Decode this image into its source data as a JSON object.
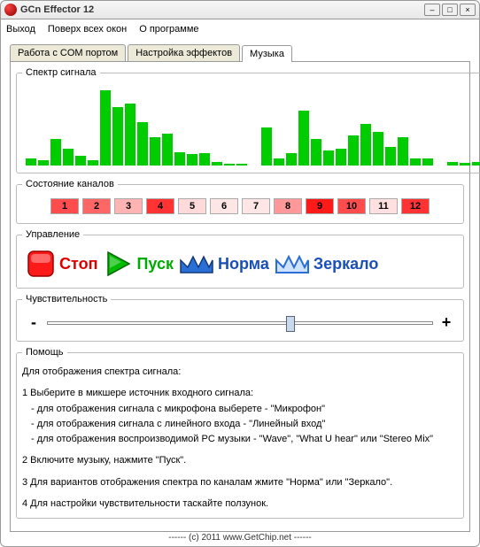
{
  "window": {
    "title": "GCn Effector 12"
  },
  "menu": {
    "exit": "Выход",
    "ontop": "Поверх всех окон",
    "about": "О программе"
  },
  "tabs": {
    "com": "Работа с COM портом",
    "effects": "Настройка эффектов",
    "music": "Музыка"
  },
  "spectrum": {
    "legend": "Спектр сигнала"
  },
  "chart_data": {
    "type": "bar",
    "title": "Спектр сигнала",
    "xlabel": "",
    "ylabel": "",
    "ylim": [
      0,
      100
    ],
    "values": [
      8,
      6,
      32,
      20,
      12,
      6,
      90,
      70,
      74,
      52,
      34,
      38,
      16,
      14,
      15,
      4,
      2,
      2,
      0,
      45,
      8,
      15,
      65,
      32,
      18,
      20,
      36,
      50,
      40,
      22,
      34,
      8,
      8,
      0,
      4,
      3,
      4,
      4,
      3,
      3
    ]
  },
  "channels": {
    "legend": "Состояние каналов",
    "items": [
      {
        "n": "1",
        "c": "#ff4d4d"
      },
      {
        "n": "2",
        "c": "#ff6666"
      },
      {
        "n": "3",
        "c": "#ffb3b3"
      },
      {
        "n": "4",
        "c": "#ff3333"
      },
      {
        "n": "5",
        "c": "#ffdada"
      },
      {
        "n": "6",
        "c": "#ffe6e6"
      },
      {
        "n": "7",
        "c": "#ffe6e6"
      },
      {
        "n": "8",
        "c": "#ff9999"
      },
      {
        "n": "9",
        "c": "#ff1a1a"
      },
      {
        "n": "10",
        "c": "#ff4d4d"
      },
      {
        "n": "11",
        "c": "#ffe0e0"
      },
      {
        "n": "12",
        "c": "#ff3333"
      }
    ]
  },
  "controls": {
    "legend": "Управление",
    "stop": "Стоп",
    "play": "Пуск",
    "normal": "Норма",
    "mirror": "Зеркало"
  },
  "sensitivity": {
    "legend": "Чувствительность",
    "minus": "-",
    "plus": "+",
    "value_pct": 62
  },
  "help": {
    "legend": "Помощь",
    "l0": "Для отображения спектра сигнала:",
    "l1": "1 Выберите в микшере источник входного сигнала:",
    "l1a": "- для отображения сигнала с микрофона выберете - \"Микрофон\"",
    "l1b": "- для отображения сигнала с линейного входа - \"Линейный вход\"",
    "l1c": "- для отображения воспроизводимой PC музыки - \"Wave\", \"What U hear\" или \"Stereo Mix\"",
    "l2": "2 Включите музыку, нажмите \"Пуск\".",
    "l3": "3 Для вариантов отображения спектра по каналам жмите \"Норма\" или \"Зеркало\".",
    "l4": "4 Для настройки чувствительности таскайте ползунок."
  },
  "footer": "------   (c) 2011   www.GetChip.net   ------"
}
